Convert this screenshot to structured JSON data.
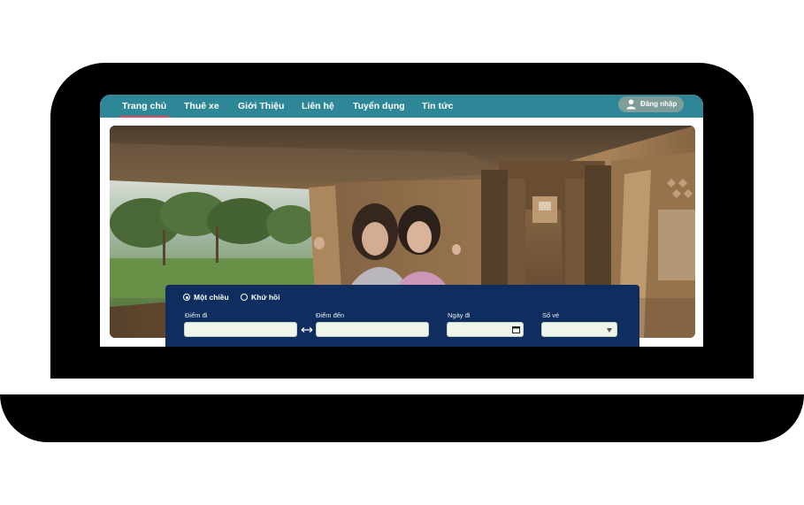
{
  "nav": {
    "items": [
      {
        "label": "Trang chủ",
        "active": true
      },
      {
        "label": "Thuê xe",
        "active": false
      },
      {
        "label": "Giới Thiệu",
        "active": false
      },
      {
        "label": "Liên hệ",
        "active": false
      },
      {
        "label": "Tuyển dụng",
        "active": false
      },
      {
        "label": "Tin tức",
        "active": false
      }
    ],
    "login_label": "Đăng nhập",
    "login_icon": "user-icon"
  },
  "hero": {
    "image": "sleeper-bus-interior-photo"
  },
  "search": {
    "trip_types": [
      {
        "label": "Một chiều",
        "selected": true
      },
      {
        "label": "Khứ hồi",
        "selected": false
      }
    ],
    "from_label": "Điểm đi",
    "from_value": "",
    "to_label": "Điểm đến",
    "to_value": "",
    "date_label": "Ngày đi",
    "date_value": "",
    "tickets_label": "Số vé",
    "tickets_value": "",
    "swap_icon": "swap-arrows-icon"
  },
  "colors": {
    "navbar": "#2d8796",
    "active_underline": "#e2475f",
    "search_panel": "#0f2d5e",
    "login_button": "#7e9c99"
  }
}
